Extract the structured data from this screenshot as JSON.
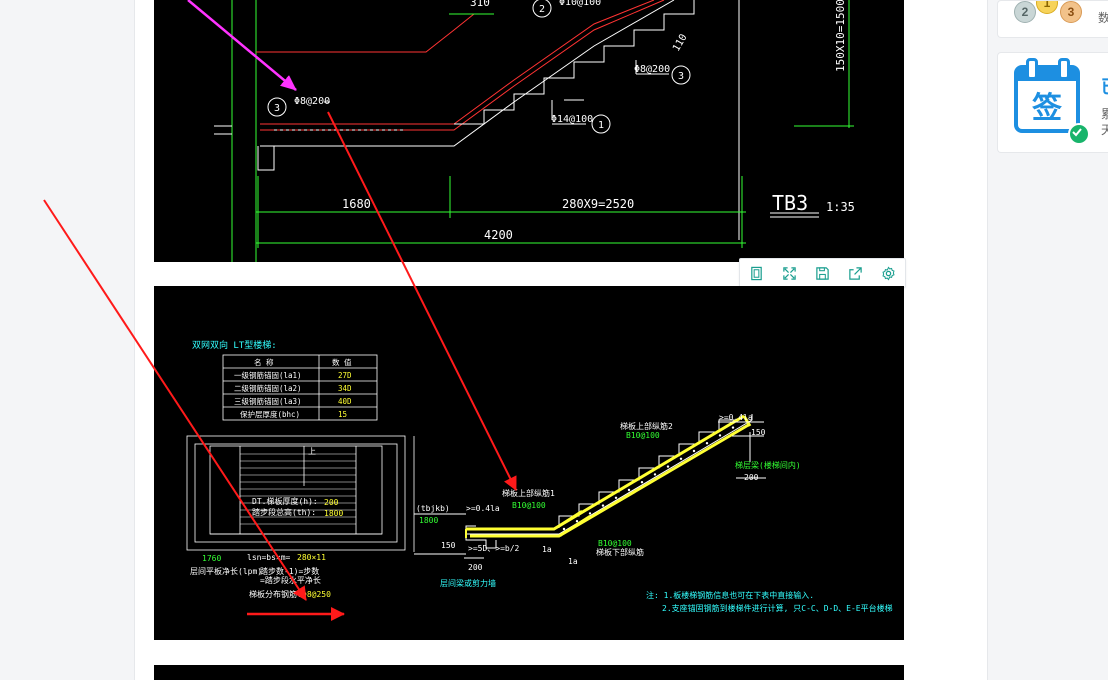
{
  "drawing_top": {
    "annotations": {
      "rebar_1": "Φ14@100",
      "rebar_2": "Φ10@100",
      "rebar_3_upper": "Φ8@200",
      "rebar_3_lower": "Φ8@200",
      "circle_1": "1",
      "circle_2": "2",
      "circle_3a": "3",
      "circle_3b": "3",
      "slab_mark": "110",
      "dim_top": "310",
      "dim_vertical": "150X10=1500",
      "dim_landing": "1680",
      "dim_steps": "280X9=2520",
      "dim_total": "4200",
      "stair_label": "TB3",
      "scale": "1:35"
    }
  },
  "toolbar": {
    "buttons": [
      {
        "name": "fit-page-icon"
      },
      {
        "name": "fullscreen-icon"
      },
      {
        "name": "save-icon"
      },
      {
        "name": "share-icon"
      },
      {
        "name": "settings-icon"
      }
    ]
  },
  "drawing_mid": {
    "heading": "双网双向 LT型楼梯:",
    "table": {
      "headers": [
        "名 称",
        "数 值"
      ],
      "rows": [
        [
          "一级钢筋锚固(la1)",
          "27D"
        ],
        [
          "二级钢筋锚固(la2)",
          "34D"
        ],
        [
          "三级钢筋锚固(la3)",
          "40D"
        ],
        [
          "保护层厚度(bhc)",
          "15"
        ]
      ]
    },
    "plan_label_mark": "上",
    "plan_labels": {
      "dt_label": "DT.梯板厚度(h):",
      "dt_value": "200",
      "step_label": "踏步段总高(th):",
      "step_value": "1800",
      "dim_left": "1760",
      "dim_mid": "lsn=bs×m=",
      "dim_mid_value": "280×11",
      "landing_len": "层间平板净长(lpm)",
      "steps_count": "踏步数-1)=步数",
      "steps_total": "=踏步段水平净长",
      "dist_rebar": "梯板分布钢筋:",
      "dist_rebar_value": "Φ8@250"
    },
    "section_labels": {
      "upper_rebar_2": "梯板上部纵筋2",
      "upper_rebar_2_val": "B10@100",
      "ge_04la_top": ">=0.4la",
      "dim_150_top": "150",
      "ladder_beam": "梯层梁(楼梯间内)",
      "dim_200_right": "200",
      "upper_rebar_1": "梯板上部纵筋1",
      "upper_rebar_1_val": "B10@100",
      "ge_04la_left": ">=0.4la",
      "tbjkb": "(tbjkb)",
      "dim_1800": "1800",
      "dim_150_left": "150",
      "ge_5d": ">=5D、>=b/2",
      "dim_200_bottom": "200",
      "beam_note": "层间梁或剪力墙",
      "la_1": "1a",
      "la_2": "1a",
      "lower_rebar_val": "B10@100",
      "lower_rebar": "梯板下部纵筋"
    },
    "notes": [
      "注: 1.板楼梯钢筋信息也可在下表中直接输入.",
      "2.支座锚固钢筋到楼梯件进行计算, 只C-C、D-D、E-E平台楼梯"
    ]
  },
  "sidebar": {
    "rank": {
      "medal_1": "1",
      "medal_2": "2",
      "medal_3": "3",
      "text": "数"
    },
    "sign_card": {
      "icon_char": "签",
      "title": "已",
      "line_1": "累",
      "line_2": "天"
    }
  },
  "colors": {
    "accent": "#1d8fe1",
    "annotation_red": "#ff1a1a",
    "annotation_magenta": "#ff33ff",
    "cad_green": "#33ff33",
    "cad_yellow": "#ffff33",
    "cad_cyan": "#33ffff",
    "check_green": "#18b46b"
  }
}
